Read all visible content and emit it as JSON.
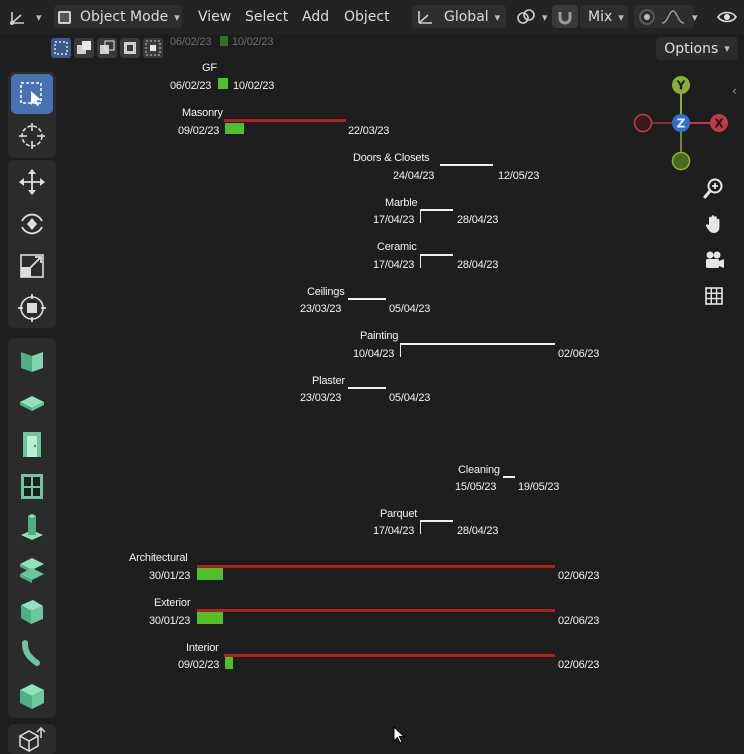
{
  "header": {
    "mode_label": "Object Mode",
    "menus": [
      "View",
      "Select",
      "Add",
      "Object"
    ],
    "transform_orientation": "Global",
    "proportional_mode": "Mix",
    "options_label": "Options"
  },
  "gizmo": {
    "y": "Y",
    "z": "Z",
    "x": "X"
  },
  "ghost_row": {
    "start": "06/02/23",
    "end": "10/02/23"
  },
  "tasks": [
    {
      "name": "GF",
      "start": "06/02/23",
      "end": "10/02/23"
    },
    {
      "name": "Masonry",
      "start": "09/02/23",
      "end": "22/03/23"
    },
    {
      "name": "Doors & Closets",
      "start": "24/04/23",
      "end": "12/05/23"
    },
    {
      "name": "Marble",
      "start": "17/04/23",
      "end": "28/04/23"
    },
    {
      "name": "Ceramic",
      "start": "17/04/23",
      "end": "28/04/23"
    },
    {
      "name": "Ceilings",
      "start": "23/03/23",
      "end": "05/04/23"
    },
    {
      "name": "Painting",
      "start": "10/04/23",
      "end": "02/06/23"
    },
    {
      "name": "Plaster",
      "start": "23/03/23",
      "end": "05/04/23"
    },
    {
      "name": "Cleaning",
      "start": "15/05/23",
      "end": "19/05/23"
    },
    {
      "name": "Parquet",
      "start": "17/04/23",
      "end": "28/04/23"
    },
    {
      "name": "Architectural",
      "start": "30/01/23",
      "end": "02/06/23"
    },
    {
      "name": "Exterior",
      "start": "30/01/23",
      "end": "02/06/23"
    },
    {
      "name": "Interior",
      "start": "09/02/23",
      "end": "02/06/23"
    }
  ]
}
